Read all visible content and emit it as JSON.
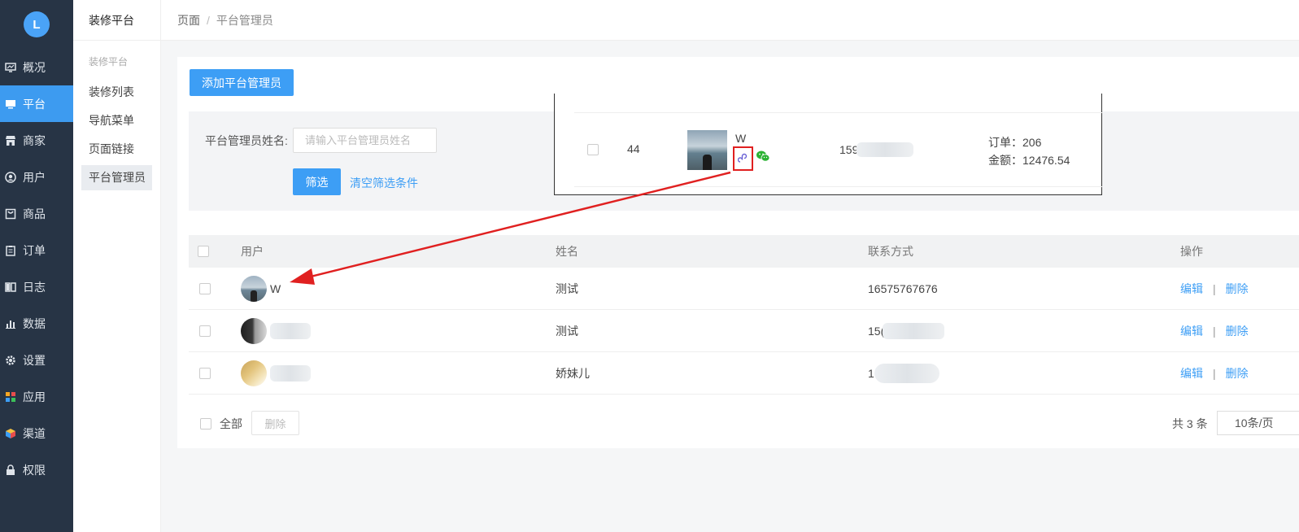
{
  "nav": {
    "logo": "L",
    "items": [
      {
        "label": "概况",
        "icon": "overview-icon"
      },
      {
        "label": "平台",
        "icon": "monitor-icon"
      },
      {
        "label": "商家",
        "icon": "store-icon"
      },
      {
        "label": "用户",
        "icon": "user-icon"
      },
      {
        "label": "商品",
        "icon": "bag-icon"
      },
      {
        "label": "订单",
        "icon": "clipboard-icon"
      },
      {
        "label": "日志",
        "icon": "book-icon"
      },
      {
        "label": "数据",
        "icon": "bar-chart-icon"
      },
      {
        "label": "设置",
        "icon": "gear-icon"
      },
      {
        "label": "应用",
        "icon": "apps-grid-icon"
      },
      {
        "label": "渠道",
        "icon": "cube-icon"
      },
      {
        "label": "权限",
        "icon": "lock-icon"
      }
    ],
    "active_index": 1
  },
  "submenu": {
    "title": "装修平台",
    "group": "装修平台",
    "items": [
      "装修列表",
      "导航菜单",
      "页面链接",
      "平台管理员"
    ],
    "active_index": 3
  },
  "breadcrumb": {
    "root": "页面",
    "sep": "/",
    "current": "平台管理员"
  },
  "toolbar": {
    "add_label": "添加平台管理员"
  },
  "filter": {
    "name_label": "平台管理员姓名:",
    "name_placeholder": "请输入平台管理员姓名",
    "name_value": "",
    "submit_label": "筛选",
    "clear_label": "清空筛选条件"
  },
  "table": {
    "headers": {
      "user": "用户",
      "name": "姓名",
      "contact": "联系方式",
      "ops": "操作"
    },
    "rows": [
      {
        "user": "W",
        "name": "测试",
        "phone": "16575767676"
      },
      {
        "user": "",
        "name": "测试",
        "phone": "15("
      },
      {
        "user": "",
        "name": "娇妹儿",
        "phone": "1"
      }
    ],
    "edit_label": "编辑",
    "ops_sep": "|",
    "delete_label": "删除"
  },
  "footer": {
    "all_label": "全部",
    "delete_label": "删除",
    "total": "共 3 条",
    "page_size": "10条/页"
  },
  "zoom": {
    "id": "44",
    "user": "W",
    "phone": "159",
    "order_line": "订单：206",
    "amount_line": "金额：12476.54"
  },
  "colors": {
    "primary": "#3d9ef5",
    "nav_bg": "#273445",
    "annotation": "#e02020",
    "wechat": "#2bb233"
  }
}
